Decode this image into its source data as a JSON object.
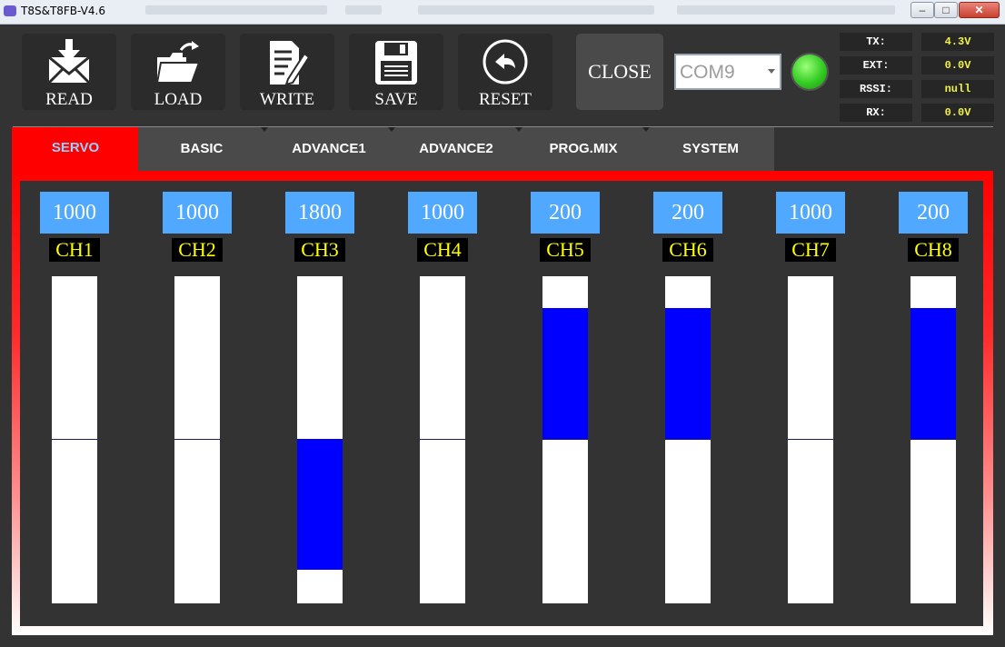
{
  "window": {
    "title": "T8S&T8FB-V4.6",
    "minimize": "–",
    "maximize": "□",
    "close": "✕"
  },
  "toolbar": {
    "read": {
      "label": "READ",
      "icon": "envelope-download-icon"
    },
    "load": {
      "label": "LOAD",
      "icon": "folder-open-icon"
    },
    "write": {
      "label": "WRITE",
      "icon": "document-edit-icon"
    },
    "save": {
      "label": "SAVE",
      "icon": "floppy-disk-icon"
    },
    "reset": {
      "label": "RESET",
      "icon": "undo-arrow-icon"
    }
  },
  "connection": {
    "close_label": "CLOSE",
    "port": "COM9",
    "status_color": "#33cc22"
  },
  "telemetry": [
    {
      "label": "TX:",
      "value": "4.3V"
    },
    {
      "label": "EXT:",
      "value": "0.0V"
    },
    {
      "label": "RSSI:",
      "value": "null"
    },
    {
      "label": "RX:",
      "value": "0.0V"
    }
  ],
  "tabs": [
    {
      "label": "SERVO",
      "active": true
    },
    {
      "label": "BASIC",
      "active": false
    },
    {
      "label": "ADVANCE1",
      "active": false
    },
    {
      "label": "ADVANCE2",
      "active": false
    },
    {
      "label": "PROG.MIX",
      "active": false
    },
    {
      "label": "SYSTEM",
      "active": false
    }
  ],
  "servo": {
    "range": [
      0,
      2000
    ],
    "center": 1000,
    "fill_color": "#0000ff",
    "channels": [
      {
        "name": "CH1",
        "value": "1000"
      },
      {
        "name": "CH2",
        "value": "1000"
      },
      {
        "name": "CH3",
        "value": "1800"
      },
      {
        "name": "CH4",
        "value": "1000"
      },
      {
        "name": "CH5",
        "value": "200"
      },
      {
        "name": "CH6",
        "value": "200"
      },
      {
        "name": "CH7",
        "value": "1000"
      },
      {
        "name": "CH8",
        "value": "200"
      }
    ]
  }
}
